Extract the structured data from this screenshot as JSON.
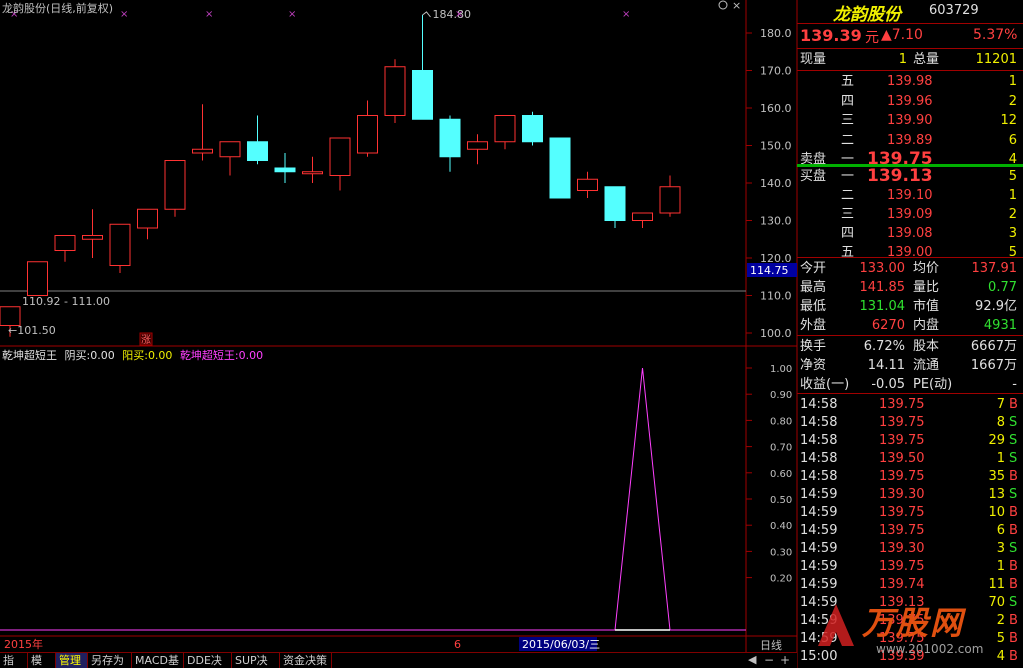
{
  "header": {
    "title": "龙韵股份(日线,前复权)"
  },
  "price_axis": {
    "labels": [
      "180.0",
      "170.0",
      "160.0",
      "150.0",
      "140.0",
      "130.0",
      "120.0",
      "110.0",
      "100.0"
    ],
    "current_tag": "114.75"
  },
  "annotations": {
    "high": "184.80",
    "range": "110.92 - 111.00",
    "low": "101.50",
    "zhang": "涨"
  },
  "indicator": {
    "name": "乾坤超短王",
    "yin_label": "阴买:",
    "yin_value": "0.00",
    "yang_label": "阳买:",
    "yang_value": "0.00",
    "name2": "乾坤超短王:",
    "value2": "0.00",
    "axis": [
      "1.00",
      "0.90",
      "0.80",
      "0.70",
      "0.60",
      "0.50",
      "0.40",
      "0.30",
      "0.20"
    ]
  },
  "chart_data": [
    {
      "type": "candlestick",
      "title": "龙韵股份(日线,前复权)",
      "ylim": [
        95,
        186
      ],
      "candles": [
        {
          "o": 102,
          "h": 107,
          "l": 99,
          "c": 107
        },
        {
          "o": 110,
          "h": 113,
          "l": 110,
          "c": 119
        },
        {
          "o": 122,
          "h": 125,
          "l": 119,
          "c": 126
        },
        {
          "o": 125,
          "h": 133,
          "l": 120,
          "c": 126
        },
        {
          "o": 118,
          "h": 129,
          "l": 116,
          "c": 129
        },
        {
          "o": 128,
          "h": 133,
          "l": 125,
          "c": 133
        },
        {
          "o": 133,
          "h": 146,
          "l": 131,
          "c": 146
        },
        {
          "o": 148,
          "h": 161,
          "l": 146,
          "c": 149
        },
        {
          "o": 147,
          "h": 150,
          "l": 142,
          "c": 151
        },
        {
          "o": 151,
          "h": 158,
          "l": 145,
          "c": 146
        },
        {
          "o": 144,
          "h": 148,
          "l": 140,
          "c": 143
        },
        {
          "o": 143,
          "h": 147,
          "l": 140,
          "c": 143
        },
        {
          "o": 142,
          "h": 151,
          "l": 138,
          "c": 152
        },
        {
          "o": 148,
          "h": 162,
          "l": 147,
          "c": 158
        },
        {
          "o": 158,
          "h": 173,
          "l": 156,
          "c": 171
        },
        {
          "o": 170,
          "h": 184.8,
          "l": 157,
          "c": 157
        },
        {
          "o": 157,
          "h": 158,
          "l": 143,
          "c": 147
        },
        {
          "o": 149,
          "h": 153,
          "l": 145,
          "c": 151
        },
        {
          "o": 151,
          "h": 158,
          "l": 149,
          "c": 158
        },
        {
          "o": 158,
          "h": 159,
          "l": 150,
          "c": 151
        },
        {
          "o": 152,
          "h": 152,
          "l": 136,
          "c": 136
        },
        {
          "o": 138,
          "h": 143,
          "l": 136,
          "c": 141
        },
        {
          "o": 139,
          "h": 139,
          "l": 128,
          "c": 130
        },
        {
          "o": 130,
          "h": 132,
          "l": 128,
          "c": 132
        },
        {
          "o": 132,
          "h": 142,
          "l": 131,
          "c": 139
        }
      ]
    },
    {
      "type": "line",
      "title": "乾坤超短王",
      "ylim": [
        0,
        1.05
      ],
      "values": [
        0,
        0,
        0,
        0,
        0,
        0,
        0,
        0,
        0,
        0,
        0,
        0,
        0,
        0,
        0,
        0,
        0,
        0,
        0,
        0,
        0,
        0,
        0,
        1,
        0
      ]
    }
  ],
  "xaxis": {
    "labels": [
      "2015年",
      "6",
      "2015/06/03/三"
    ]
  },
  "quote": {
    "name": "龙韵股份",
    "code": "603729",
    "price": "139.39",
    "unit": "元",
    "change": "▲7.10",
    "pct": "5.37%",
    "xianliang_label": "现量",
    "xianliang": "1",
    "zongliang_label": "总量",
    "zongliang": "11201",
    "sell_label": "卖盘",
    "sells": [
      {
        "label": "五",
        "price": "139.98",
        "vol": "1"
      },
      {
        "label": "四",
        "price": "139.96",
        "vol": "2"
      },
      {
        "label": "三",
        "price": "139.90",
        "vol": "12"
      },
      {
        "label": "二",
        "price": "139.89",
        "vol": "6"
      },
      {
        "label": "一",
        "price": "139.75",
        "vol": "4"
      }
    ],
    "buy_label": "买盘",
    "buys": [
      {
        "label": "一",
        "price": "139.13",
        "vol": "5"
      },
      {
        "label": "二",
        "price": "139.10",
        "vol": "1"
      },
      {
        "label": "三",
        "price": "139.09",
        "vol": "2"
      },
      {
        "label": "四",
        "price": "139.08",
        "vol": "3"
      },
      {
        "label": "五",
        "price": "139.00",
        "vol": "5"
      }
    ],
    "stats": [
      {
        "l1": "今开",
        "v1": "133.00",
        "c1": "red",
        "l2": "均价",
        "v2": "137.91",
        "c2": "red"
      },
      {
        "l1": "最高",
        "v1": "141.85",
        "c1": "red",
        "l2": "量比",
        "v2": "0.77",
        "c2": "grn"
      },
      {
        "l1": "最低",
        "v1": "131.04",
        "c1": "grn",
        "l2": "市值",
        "v2": "92.9亿",
        "c2": "wht"
      },
      {
        "l1": "外盘",
        "v1": "6270",
        "c1": "red",
        "l2": "内盘",
        "v2": "4931",
        "c2": "grn"
      }
    ],
    "stats2": [
      {
        "l1": "换手",
        "v1": "6.72%",
        "l2": "股本",
        "v2": "6667万"
      },
      {
        "l1": "净资",
        "v1": "14.11",
        "l2": "流通",
        "v2": "1667万"
      },
      {
        "l1": "收益(一)",
        "v1": "-0.05",
        "l2": "PE(动)",
        "v2": "-"
      }
    ]
  },
  "ticks": [
    {
      "t": "14:58",
      "p": "139.75",
      "v": "7",
      "s": "B"
    },
    {
      "t": "14:58",
      "p": "139.75",
      "v": "8",
      "s": "S"
    },
    {
      "t": "14:58",
      "p": "139.75",
      "v": "29",
      "s": "S"
    },
    {
      "t": "14:58",
      "p": "139.50",
      "v": "1",
      "s": "S"
    },
    {
      "t": "14:58",
      "p": "139.75",
      "v": "35",
      "s": "B"
    },
    {
      "t": "14:59",
      "p": "139.30",
      "v": "13",
      "s": "S"
    },
    {
      "t": "14:59",
      "p": "139.75",
      "v": "10",
      "s": "B"
    },
    {
      "t": "14:59",
      "p": "139.75",
      "v": "6",
      "s": "B"
    },
    {
      "t": "14:59",
      "p": "139.30",
      "v": "3",
      "s": "S"
    },
    {
      "t": "14:59",
      "p": "139.75",
      "v": "1",
      "s": "B"
    },
    {
      "t": "14:59",
      "p": "139.74",
      "v": "11",
      "s": "B"
    },
    {
      "t": "14:59",
      "p": "139.13",
      "v": "70",
      "s": "S"
    },
    {
      "t": "14:59",
      "p": "139.75",
      "v": "2",
      "s": "B"
    },
    {
      "t": "14:59",
      "p": "139.75",
      "v": "5",
      "s": "B"
    },
    {
      "t": "15:00",
      "p": "139.39",
      "v": "4",
      "s": "B"
    }
  ],
  "tabs": [
    "指标",
    "模板",
    "管理",
    "另存为",
    "MACD基本",
    "DDE决策",
    "SUP决策",
    "资金决策"
  ],
  "period": "日线",
  "watermark": {
    "brand": "万股网",
    "url": "www.201002.com"
  }
}
